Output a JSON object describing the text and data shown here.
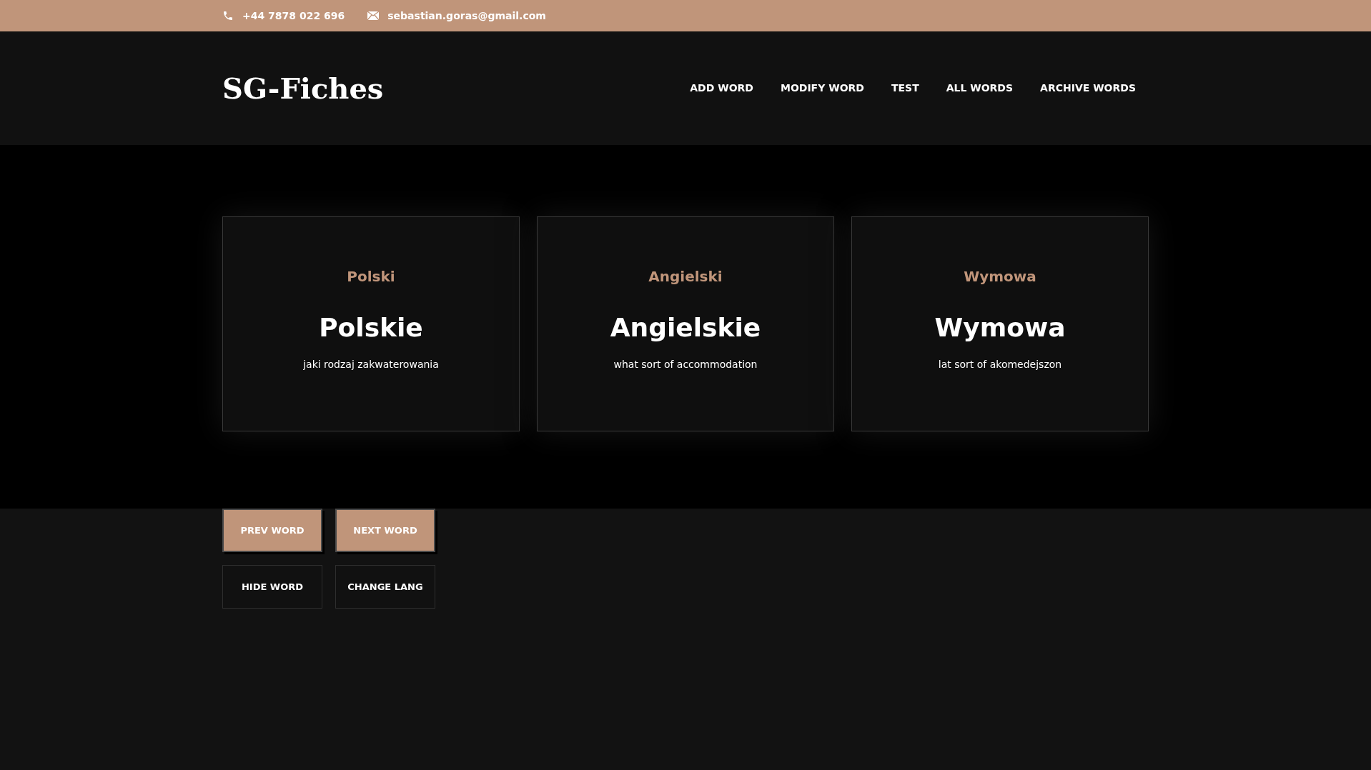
{
  "topbar": {
    "phone": "+44 7878 022 696",
    "email": "sebastian.goras@gmail.com"
  },
  "header": {
    "logo": "SG-Fiches",
    "nav": [
      {
        "label": "ADD WORD"
      },
      {
        "label": "MODIFY WORD"
      },
      {
        "label": "TEST"
      },
      {
        "label": "ALL WORDS"
      },
      {
        "label": "ARCHIVE WORDS"
      }
    ]
  },
  "cards": [
    {
      "label": "Polski",
      "word": "Polskie",
      "phrase": "jaki rodzaj zakwaterowania"
    },
    {
      "label": "Angielski",
      "word": "Angielskie",
      "phrase": "what sort of accommodation"
    },
    {
      "label": "Wymowa",
      "word": "Wymowa",
      "phrase": "lat sort of akomedejszon"
    }
  ],
  "button_rows": [
    [
      {
        "label": "PREV WORD",
        "kind": "filled"
      },
      {
        "label": "NEXT WORD",
        "kind": "filled"
      }
    ],
    [
      {
        "label": "HIDE WORD",
        "kind": "outline"
      },
      {
        "label": "CHANGE LANG",
        "kind": "outline"
      }
    ]
  ]
}
